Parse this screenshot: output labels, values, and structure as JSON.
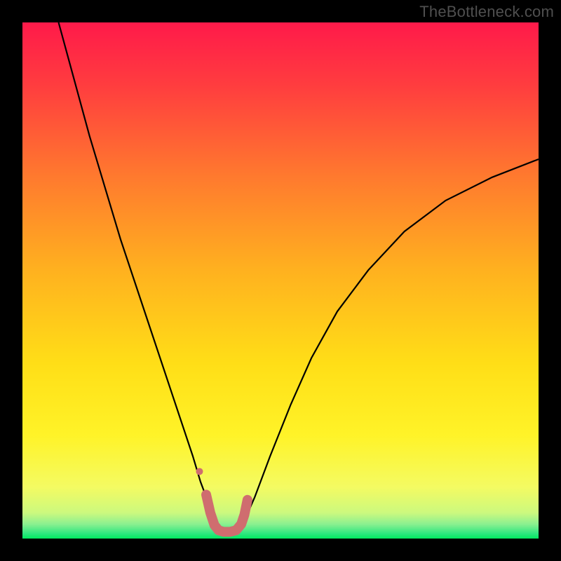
{
  "watermark": "TheBottleneck.com",
  "chart_data": {
    "type": "line",
    "title": "",
    "xlabel": "",
    "ylabel": "",
    "xlim": [
      0,
      100
    ],
    "ylim": [
      0,
      100
    ],
    "grid": false,
    "legend": false,
    "background_gradient": {
      "top_color": "#ff1a4a",
      "mid_color": "#ffe317",
      "bottom_band_color": "#00e85f",
      "bottom_band_height_pct": 3
    },
    "series": [
      {
        "name": "bottleneck-curve",
        "stroke": "#000000",
        "stroke_width": 2.2,
        "x": [
          7,
          10,
          13,
          16,
          19,
          22,
          25,
          27,
          29,
          31,
          33,
          34.5,
          36,
          37,
          37.8,
          38.5,
          41.5,
          43,
          45,
          48,
          52,
          56,
          61,
          67,
          74,
          82,
          91,
          100
        ],
        "y": [
          100,
          89,
          78,
          68,
          58,
          49,
          40,
          34,
          28,
          22,
          16,
          11,
          7,
          4.5,
          2.8,
          1.6,
          1.6,
          3.5,
          8,
          16,
          26,
          35,
          44,
          52,
          59.5,
          65.5,
          70,
          73.5
        ]
      }
    ],
    "highlight_segment": {
      "name": "minimum-highlight",
      "stroke": "#cf6d6f",
      "stroke_width": 14,
      "linecap": "round",
      "x": [
        35.6,
        36.4,
        37.2,
        38.0,
        39.0,
        40.2,
        41.4,
        42.4,
        43.0,
        43.6
      ],
      "y": [
        8.5,
        5.0,
        2.6,
        1.6,
        1.3,
        1.3,
        1.6,
        2.8,
        4.6,
        7.5
      ]
    },
    "highlight_dot": {
      "stroke": "#cf6d6f",
      "r": 5,
      "x": 34.3,
      "y": 13
    },
    "annotations": []
  }
}
